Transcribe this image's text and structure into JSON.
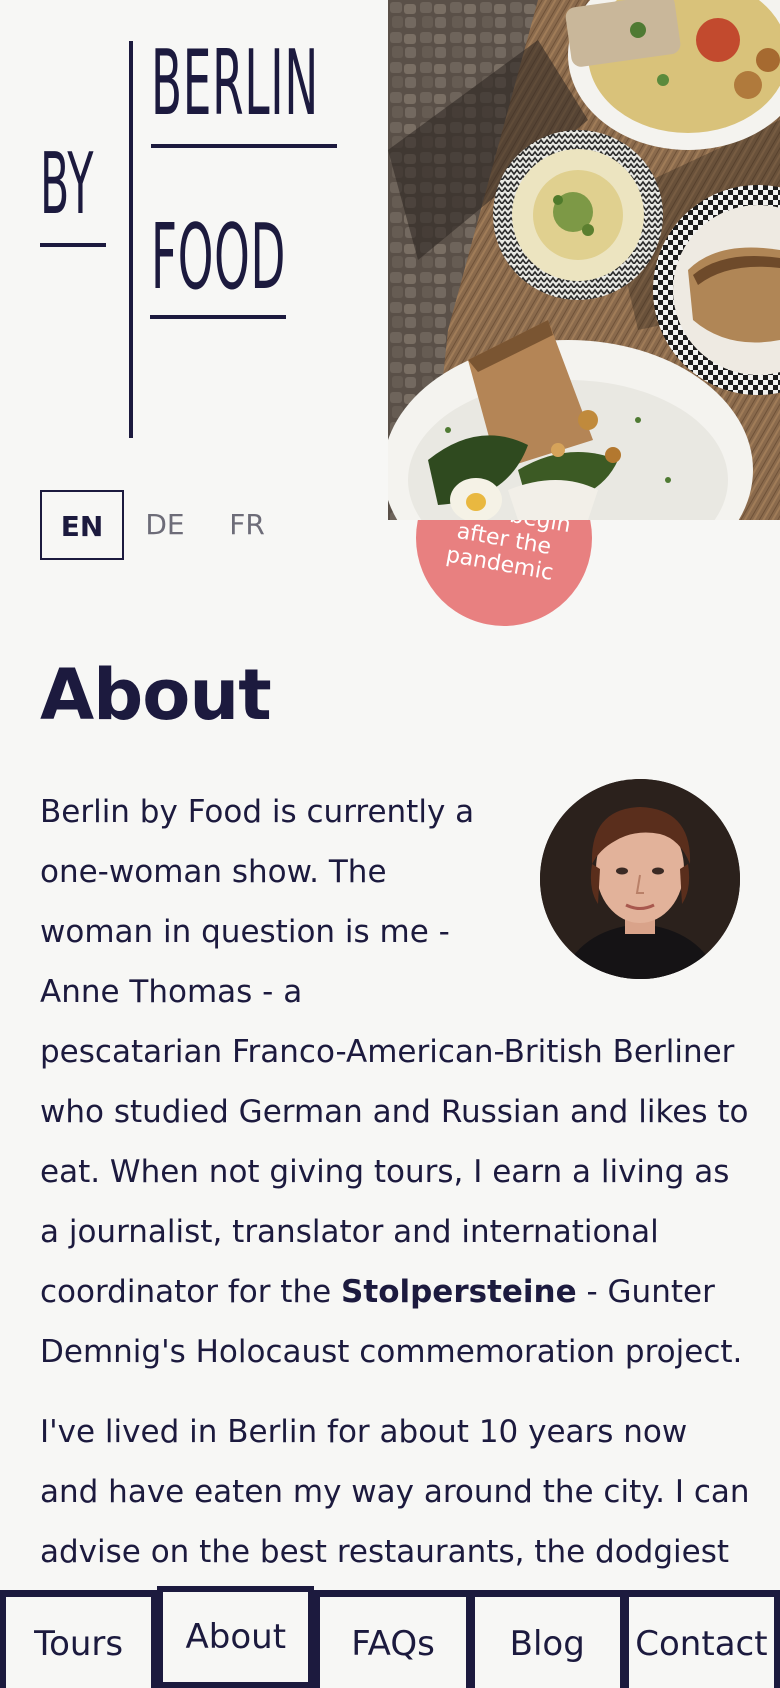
{
  "brand": {
    "word1": "BERLIN",
    "word2": "BY",
    "word3": "FOOD"
  },
  "badge": {
    "line1": "Tours begin",
    "line2": "after the",
    "line3": "pandemic"
  },
  "languages": [
    {
      "label": "EN",
      "active": true
    },
    {
      "label": "DE",
      "active": false
    },
    {
      "label": "FR",
      "active": false
    }
  ],
  "page": {
    "title": "About",
    "p1_a": "Berlin by Food is currently a one-woman show. The woman in question is me - Anne Thomas - a pescatarian Franco-American-British Berliner who studied German and Russian and likes to eat. When not giving tours, I earn a living as a journalist, translator and international coordinator for the ",
    "p1_link": "Stolpersteine",
    "p1_b": " - Gunter Demnig's Holocaust commemoration project.",
    "p2": "I've lived in Berlin for about 10 years now and have eaten my way around the city. I can advise on the best restaurants, the dodgiest"
  },
  "nav": [
    {
      "label": "Tours",
      "active": false
    },
    {
      "label": "About",
      "active": true
    },
    {
      "label": "FAQs",
      "active": false
    },
    {
      "label": "Blog",
      "active": false
    },
    {
      "label": "Contact",
      "active": false
    }
  ],
  "colors": {
    "background": "#f7f7f5",
    "ink": "#1c1a3e",
    "badge": "#e88080"
  }
}
